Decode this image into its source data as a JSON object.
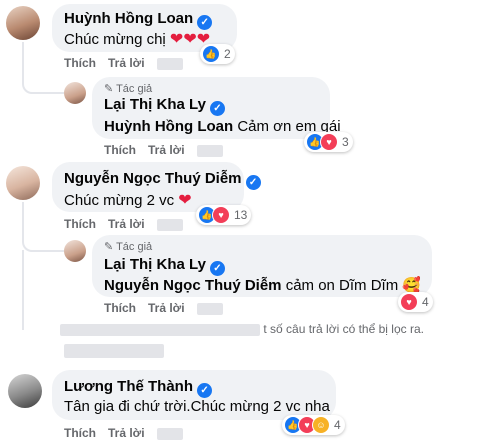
{
  "comments": [
    {
      "name": "Huỳnh Hồng Loan",
      "text": "Chúc mừng chị",
      "hearts": "❤❤❤",
      "reaction_count": "2",
      "like_label": "Thích",
      "reply_label": "Trả lời"
    },
    {
      "author_tag": "Tác giả",
      "name": "Lại Thị Kha Ly",
      "mention": "Huỳnh Hồng Loan",
      "text": "Cảm ơn em gái",
      "reaction_count": "3",
      "like_label": "Thích",
      "reply_label": "Trả lời"
    },
    {
      "name": "Nguyễn Ngọc Thuý Diễm",
      "text": "Chúc mừng 2 vc",
      "hearts": "❤",
      "reaction_count": "13",
      "like_label": "Thích",
      "reply_label": "Trả lời"
    },
    {
      "author_tag": "Tác giả",
      "name": "Lại Thị Kha Ly",
      "mention": "Nguyễn Ngọc Thuý Diễm",
      "text": "cảm on Dĩm Dĩm",
      "emoji": "🥰",
      "reaction_count": "4",
      "like_label": "Thích",
      "reply_label": "Trả lời"
    },
    {
      "name": "Lương Thế Thành",
      "text": "Tân gia đi chứ trời.Chúc mừng 2 vc nha",
      "reaction_count": "4",
      "like_label": "Thích",
      "reply_label": "Trả lời"
    }
  ],
  "hidden_notice": "t số câu trả lời có thể bị lọc ra.",
  "icons": {
    "verified": "verified-badge-icon",
    "like": "like-icon",
    "love": "love-icon",
    "care": "care-icon"
  },
  "colors": {
    "accent": "#1877f2",
    "bubble": "#f0f2f5",
    "secondary_text": "#65676b",
    "heart": "#e41e3f"
  }
}
